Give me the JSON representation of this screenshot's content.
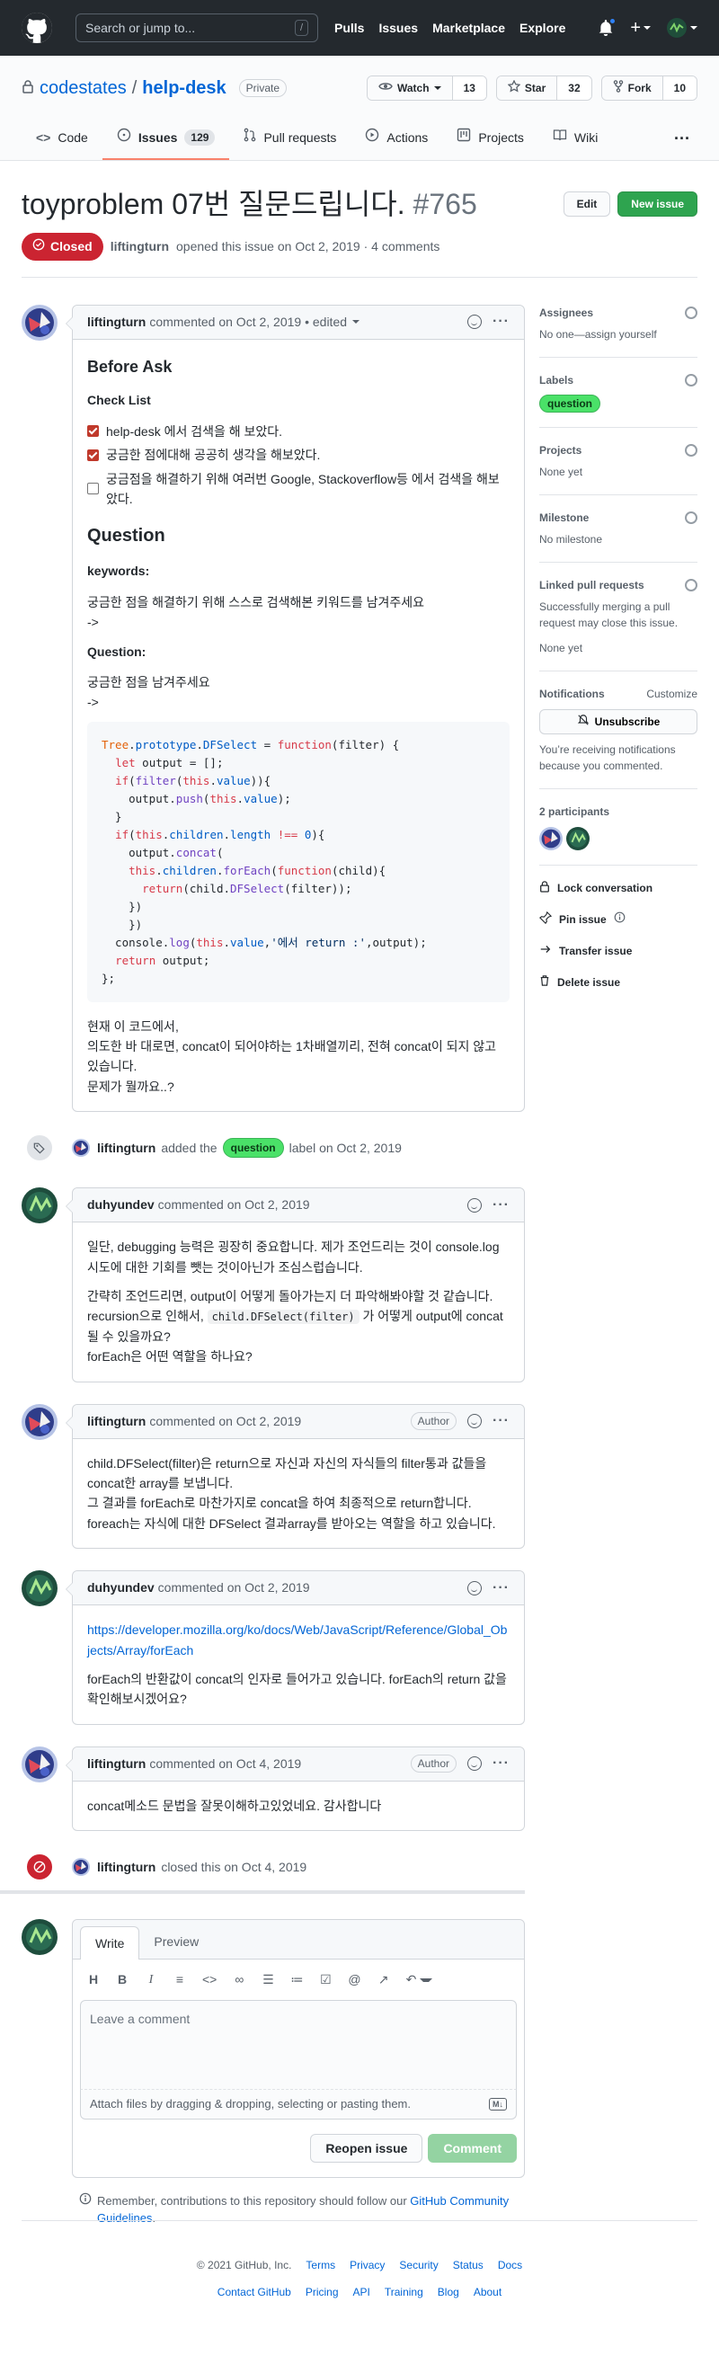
{
  "header": {
    "search_placeholder": "Search or jump to...",
    "slash": "/",
    "nav": [
      "Pulls",
      "Issues",
      "Marketplace",
      "Explore"
    ]
  },
  "repo": {
    "owner": "codestates",
    "separator": "/",
    "name": "help-desk",
    "visibility": "Private",
    "watch_label": "Watch",
    "watch_count": "13",
    "star_label": "Star",
    "star_count": "32",
    "fork_label": "Fork",
    "fork_count": "10",
    "tabs": [
      {
        "label": "Code"
      },
      {
        "label": "Issues",
        "count": "129"
      },
      {
        "label": "Pull requests"
      },
      {
        "label": "Actions"
      },
      {
        "label": "Projects"
      },
      {
        "label": "Wiki"
      }
    ]
  },
  "issue": {
    "title": "toyproblem 07번 질문드립니다.",
    "number": "#765",
    "edit_label": "Edit",
    "new_issue_label": "New issue",
    "state": "Closed",
    "author": "liftingturn",
    "meta_text": "opened this issue on Oct 2, 2019 · 4 comments"
  },
  "first_comment": {
    "author": "liftingturn",
    "meta": "commented on Oct 2, 2019 • edited",
    "h_before": "Before Ask",
    "h_checklist": "Check List",
    "checklist": [
      {
        "text": "help-desk 에서 검색을 해 보았다.",
        "checked": true
      },
      {
        "text": "궁금한 점에대해 공공히 생각을 해보았다.",
        "checked": true
      },
      {
        "text": "궁금점을 해결하기 위해 여러번 Google, Stackoverflow등 에서 검색을 해보았다.",
        "checked": false
      }
    ],
    "h_question": "Question",
    "keywords_label": "keywords:",
    "keywords_text": "궁금한 점을 해결하기 위해 스스로 검색해본 키워드를 남겨주세요",
    "arrow1": "->",
    "question_label": "Question:",
    "question_text": "궁금한 점을 남겨주세요",
    "arrow2": "->",
    "closing_1": "현재 이 코드에서,",
    "closing_2": "의도한 바 대로면, concat이 되어야하는 1차배열끼리, 전혀 concat이 되지 않고 있습니다.",
    "closing_3": "문제가 뭘까요..?"
  },
  "label_event": {
    "author": "liftingturn",
    "pre": "added the",
    "label": "question",
    "post": "label on Oct 2, 2019"
  },
  "comment2": {
    "author": "duhyundev",
    "meta": "commented on Oct 2, 2019",
    "p1": "일단, debugging 능력은 굉장히 중요합니다. 제가 조언드리는 것이 console.log 시도에 대한 기회를 뺏는 것이아닌가 조심스럽습니다.",
    "p2a": "간략히 조언드리면, output이 어떻게 돌아가는지 더 파악해봐야할 것 같습니다.",
    "p2b_pre": "recursion으로 인해서,",
    "p2b_code": "child.DFSelect(filter)",
    "p2b_post": "가 어떻게 output에 concat될 수 있을까요?",
    "p2c": "forEach은 어떤 역할을 하나요?"
  },
  "comment3": {
    "author": "liftingturn",
    "meta": "commented on Oct 2, 2019",
    "badge": "Author",
    "l1": "child.DFSelect(filter)은 return으로 자신과 자신의 자식들의 filter통과 값들을 concat한 array를 보냅니다.",
    "l2": "그 결과를 forEach로 마찬가지로 concat을 하여 최종적으로 return합니다.",
    "l3": "foreach는 자식에 대한 DFSelect 결과array를 받아오는 역할을 하고 있습니다."
  },
  "comment4": {
    "author": "duhyundev",
    "meta": "commented on Oct 2, 2019",
    "link": "https://developer.mozilla.org/ko/docs/Web/JavaScript/Reference/Global_Objects/Array/forEach",
    "p": "forEach의 반환값이 concat의 인자로 들어가고 있습니다. forEach의 return 값을 확인해보시겠어요?"
  },
  "comment5": {
    "author": "liftingturn",
    "meta": "commented on Oct 4, 2019",
    "badge": "Author",
    "p": "concat메소드 문법을 잘못이해하고있었네요. 감사합니다"
  },
  "close_event": {
    "author": "liftingturn",
    "text": "closed this on Oct 4, 2019"
  },
  "new_comment": {
    "tab_write": "Write",
    "tab_preview": "Preview",
    "placeholder": "Leave a comment",
    "attach": "Attach files by dragging & dropping, selecting or pasting them.",
    "reopen_label": "Reopen issue",
    "comment_label": "Comment",
    "guidelines_pre": "Remember, contributions to this repository should follow our",
    "guidelines_link": "GitHub Community Guidelines",
    "guidelines_post": "."
  },
  "sidebar": {
    "assignees_title": "Assignees",
    "assignees_text": "No one—assign yourself",
    "labels_title": "Labels",
    "label": "question",
    "projects_title": "Projects",
    "projects_text": "None yet",
    "milestone_title": "Milestone",
    "milestone_text": "No milestone",
    "linked_title": "Linked pull requests",
    "linked_desc": "Successfully merging a pull request may close this issue.",
    "linked_text": "None yet",
    "notifications_title": "Notifications",
    "customize": "Customize",
    "unsubscribe": "Unsubscribe",
    "notif_desc": "You’re receiving notifications because you commented.",
    "participants_title": "2 participants",
    "lock": "Lock conversation",
    "pin": "Pin issue",
    "transfer": "Transfer issue",
    "delete": "Delete issue"
  },
  "footer": {
    "copyright": "© 2021 GitHub, Inc.",
    "row1": [
      "Terms",
      "Privacy",
      "Security",
      "Status",
      "Docs"
    ],
    "row2": [
      "Contact GitHub",
      "Pricing",
      "API",
      "Training",
      "Blog",
      "About"
    ]
  },
  "colors": {
    "closed": "#cb2431",
    "label_question": "#4ae168",
    "new_issue": "#2ea44f",
    "link": "#0366d6"
  },
  "icons": [
    "github-logo-icon",
    "bell-icon",
    "plus-icon",
    "lock-icon",
    "eye-icon",
    "star-icon",
    "fork-icon",
    "code-icon",
    "issue-icon",
    "pull-request-icon",
    "play-icon",
    "project-icon",
    "book-icon",
    "kebab-icon",
    "closed-issue-icon",
    "tag-icon",
    "smiley-icon",
    "gear-icon",
    "mute-icon",
    "pin-icon",
    "arrow-right-icon",
    "trash-icon",
    "info-icon",
    "markdown-icon"
  ]
}
